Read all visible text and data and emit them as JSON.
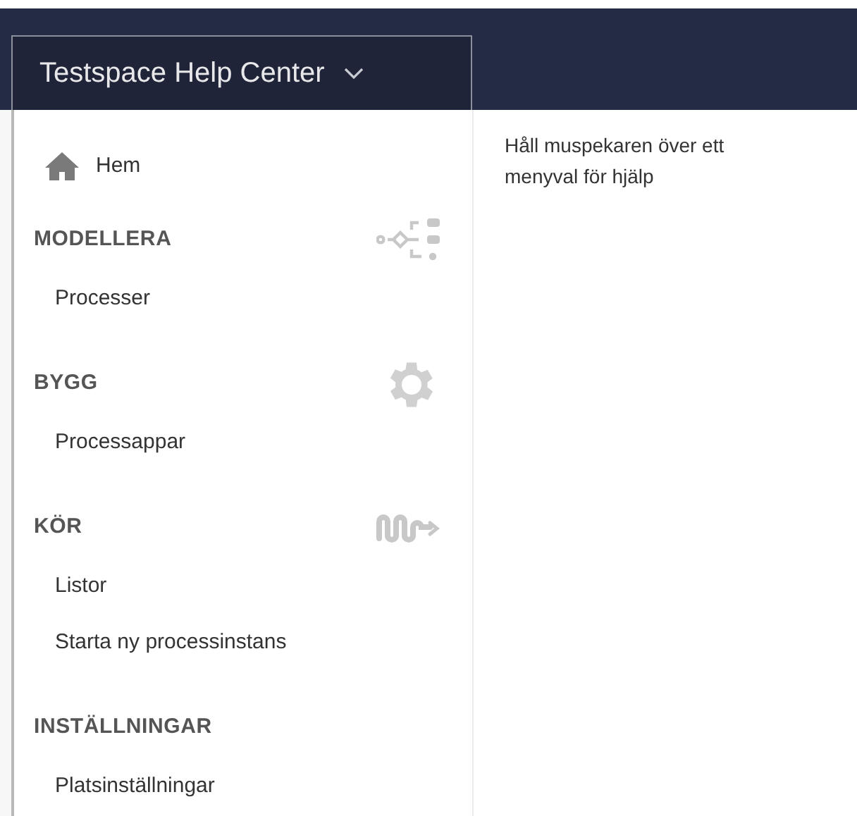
{
  "header": {
    "title": "Testspace Help Center"
  },
  "menu": {
    "home": {
      "label": "Hem"
    },
    "sections": [
      {
        "title": "MODELLERA",
        "kind": "flow",
        "items": [
          "Processer"
        ]
      },
      {
        "title": "BYGG",
        "kind": "gear",
        "items": [
          "Processappar"
        ]
      },
      {
        "title": "KÖR",
        "kind": "wave",
        "items": [
          "Listor",
          "Starta ny processinstans"
        ]
      },
      {
        "title": "INSTÄLLNINGAR",
        "kind": "plain",
        "items": [
          "Platsinställningar"
        ]
      }
    ]
  },
  "help": {
    "text": "Håll muspekaren över ett menyval för hjälp"
  }
}
